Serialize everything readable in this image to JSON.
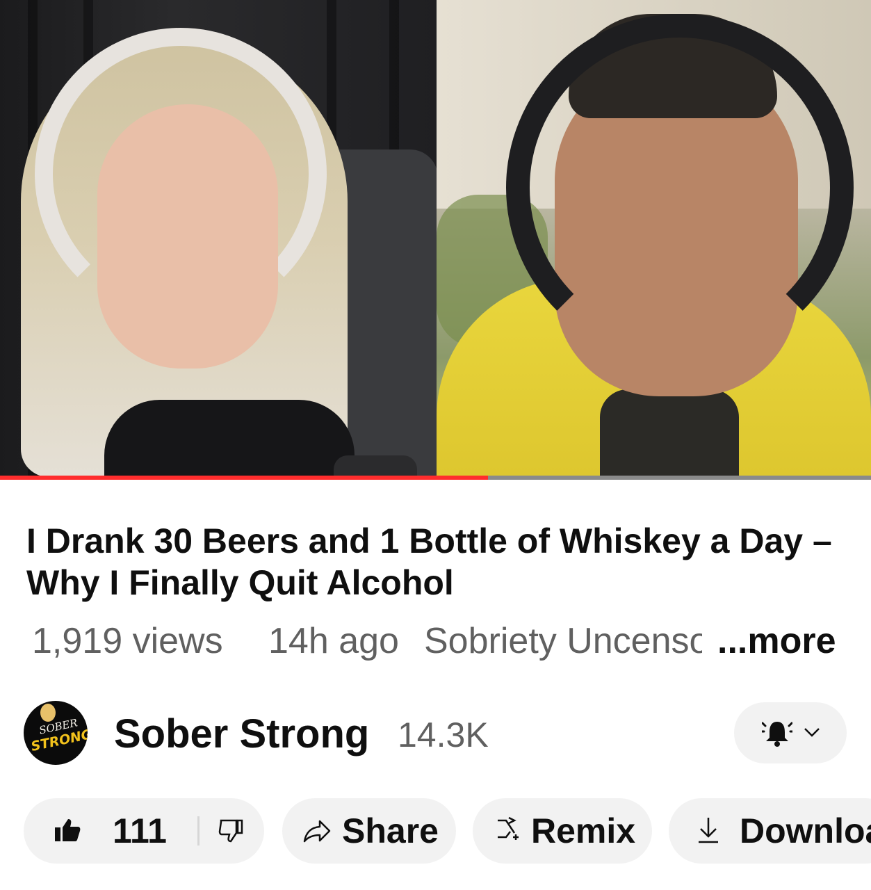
{
  "player": {
    "progress_percent": 56,
    "accent_color": "#ff2d2d"
  },
  "video": {
    "title": "I Drank 30 Beers and 1 Bottle of Whiskey a Day – Why I Finally Quit Alcohol",
    "views": "1,919 views",
    "age": "14h ago",
    "playlist": "Sobriety Uncensored",
    "more_label": "...more"
  },
  "channel": {
    "name": "Sober Strong",
    "subscribers": "14.3K",
    "avatar_logo": "SOBER STRONG",
    "avatar_text_1": "SOBER",
    "avatar_text_2": "STRONG",
    "bell_icon": "bell-ringing-icon",
    "chevron_icon": "chevron-down-icon"
  },
  "actions": {
    "like_count": "111",
    "share_label": "Share",
    "remix_label": "Remix",
    "download_label": "Download"
  }
}
